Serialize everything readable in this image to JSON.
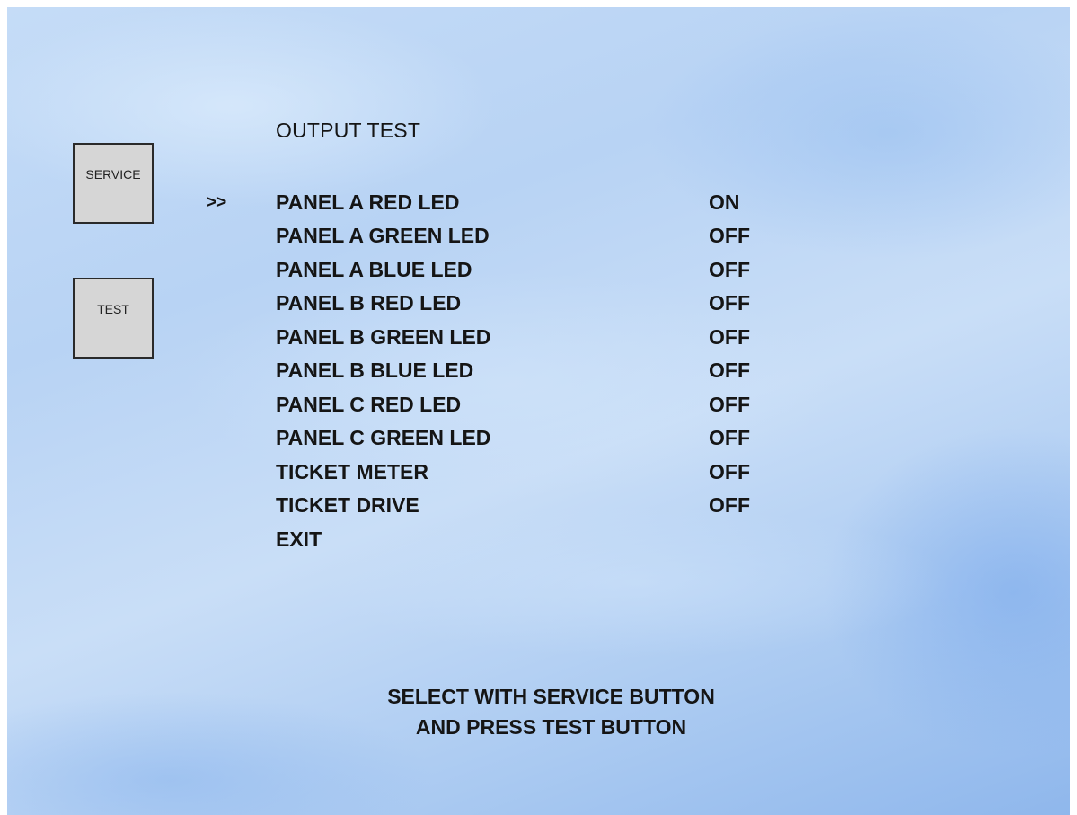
{
  "side_buttons": {
    "service": "SERVICE",
    "test": "TEST"
  },
  "title": "OUTPUT TEST",
  "cursor": ">>",
  "menu": [
    {
      "label": "PANEL A RED LED",
      "value": "ON"
    },
    {
      "label": "PANEL A GREEN LED",
      "value": "OFF"
    },
    {
      "label": "PANEL A BLUE LED",
      "value": "OFF"
    },
    {
      "label": "PANEL B RED LED",
      "value": "OFF"
    },
    {
      "label": "PANEL B GREEN LED",
      "value": "OFF"
    },
    {
      "label": "PANEL B BLUE LED",
      "value": "OFF"
    },
    {
      "label": "PANEL C RED LED",
      "value": "OFF"
    },
    {
      "label": "PANEL C GREEN LED",
      "value": "OFF"
    },
    {
      "label": "TICKET METER",
      "value": "OFF"
    },
    {
      "label": "TICKET DRIVE",
      "value": "OFF"
    },
    {
      "label": "EXIT",
      "value": ""
    }
  ],
  "instructions": {
    "line1": "SELECT WITH SERVICE BUTTON",
    "line2": "AND PRESS TEST BUTTON"
  }
}
